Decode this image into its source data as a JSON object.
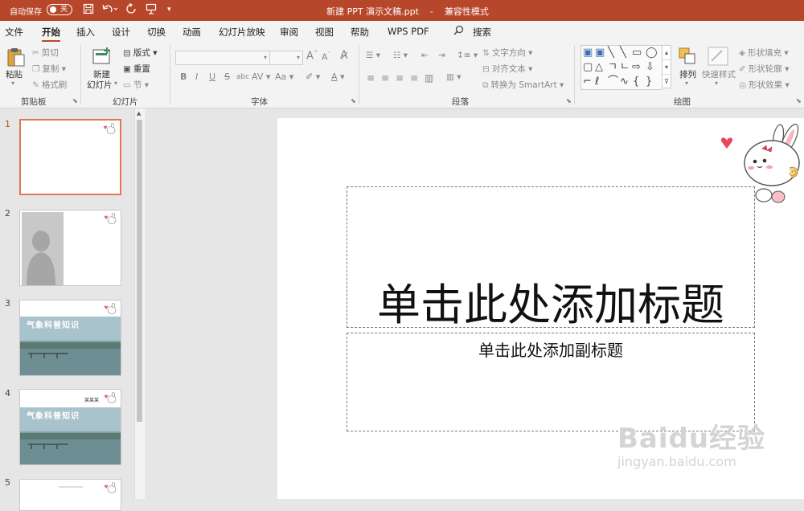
{
  "titlebar": {
    "autosave": "自动保存",
    "autosave_state": "关",
    "doc_name": "新建 PPT 演示文稿.ppt",
    "separator": "-",
    "mode": "兼容性模式"
  },
  "tabs": [
    "文件",
    "开始",
    "插入",
    "设计",
    "切换",
    "动画",
    "幻灯片放映",
    "审阅",
    "视图",
    "帮助",
    "WPS PDF"
  ],
  "active_tab": "开始",
  "search_label": "搜索",
  "ribbon": {
    "clipboard": {
      "paste": "粘贴",
      "cut": "剪切",
      "copy": "复制",
      "format_painter": "格式刷",
      "label": "剪贴板"
    },
    "slides": {
      "new_slide_line1": "新建",
      "new_slide_line2": "幻灯片",
      "layout": "版式",
      "reset": "重置",
      "section": "节",
      "label": "幻灯片"
    },
    "font": {
      "label": "字体",
      "bold": "B",
      "italic": "I",
      "underline": "U",
      "strike": "S",
      "shadow": "abc",
      "spacing": "AV",
      "case": "Aa",
      "grow": "A",
      "shrink": "A"
    },
    "paragraph": {
      "text_direction": "文字方向",
      "align_text": "对齐文本",
      "convert_smartart": "转换为 SmartArt",
      "label": "段落"
    },
    "drawing": {
      "arrange": "排列",
      "quick_styles": "快速样式",
      "shape_fill": "形状填充",
      "shape_outline": "形状轮廓",
      "shape_effects": "形状效果",
      "label": "绘图"
    }
  },
  "slides": [
    {
      "number": "1",
      "type": "title"
    },
    {
      "number": "2",
      "type": "silhouette"
    },
    {
      "number": "3",
      "type": "lake",
      "caption": "气象科普知识"
    },
    {
      "number": "4",
      "type": "lake",
      "caption": "气象科普知识",
      "small_text": "某某某"
    },
    {
      "number": "5",
      "type": "blank"
    }
  ],
  "canvas": {
    "title_placeholder": "单击此处添加标题",
    "subtitle_placeholder": "单击此处添加副标题"
  },
  "watermark": {
    "main": "Baidu经验",
    "sub": "jingyan.baidu.com"
  },
  "colors": {
    "accent": "#b7472a",
    "selection": "#e07952",
    "ribbon_bg": "#f3f3f3"
  }
}
